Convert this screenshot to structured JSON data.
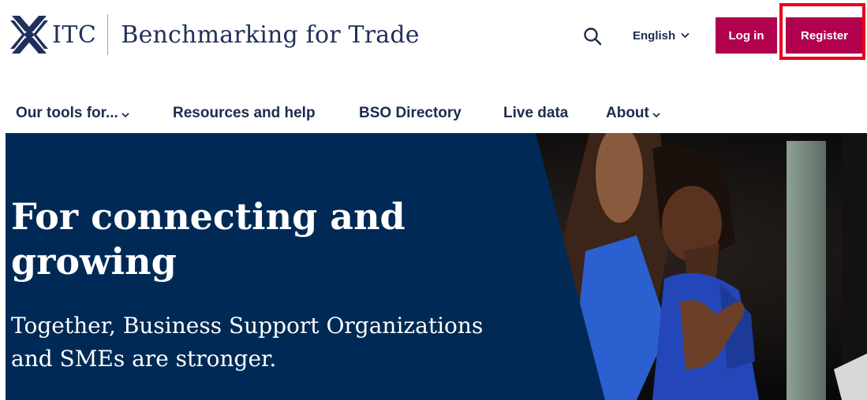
{
  "header": {
    "logo": {
      "brand": "ITC",
      "subtitle": "Benchmarking for Trade"
    },
    "search": {
      "icon": "search-icon"
    },
    "language": {
      "selected": "English",
      "icon": "chevron-down-icon"
    },
    "login_label": "Log in",
    "register_label": "Register"
  },
  "nav": {
    "items": [
      {
        "label": "Our tools for...",
        "has_dropdown": true
      },
      {
        "label": "Resources and help",
        "has_dropdown": false
      },
      {
        "label": "BSO Directory",
        "has_dropdown": false
      },
      {
        "label": "Live data",
        "has_dropdown": false
      },
      {
        "label": "About",
        "has_dropdown": true
      }
    ]
  },
  "hero": {
    "title": "For connecting and growing",
    "subtitle": "Together, Business Support Organizations and SMEs are stronger."
  },
  "colors": {
    "brand_navy": "#002a55",
    "text_navy": "#1d2b4f",
    "accent_magenta": "#b0004e",
    "highlight_red": "#e8001d"
  }
}
